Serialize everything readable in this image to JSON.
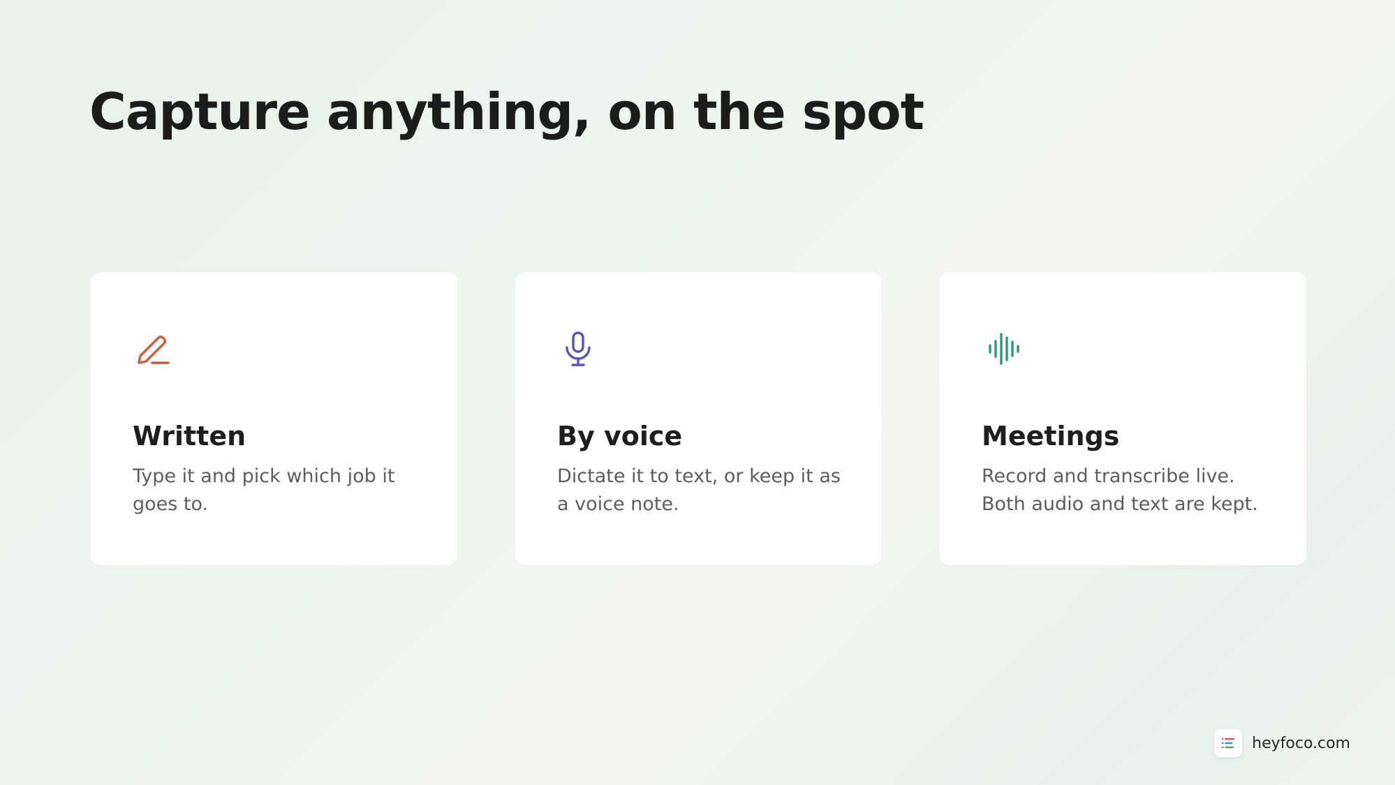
{
  "header": {
    "title": "Capture anything, on the spot"
  },
  "cards": [
    {
      "icon": "pencil-icon",
      "icon_color": "#c4603e",
      "title": "Written",
      "description": "Type it and pick which job it goes to."
    },
    {
      "icon": "microphone-icon",
      "icon_color": "#5a56b8",
      "title": "By voice",
      "description": "Dictate it to text, or keep it as a voice note."
    },
    {
      "icon": "audio-waveform-icon",
      "icon_color": "#2f9a78",
      "title": "Meetings",
      "description": "Record and transcribe live. Both audio and text are kept."
    }
  ],
  "footer": {
    "logo_icon": "list-logo-icon",
    "logo_colors": [
      "#e2524a",
      "#3f86d8",
      "#3bab72"
    ],
    "brand_text": "heyfoco.com"
  }
}
